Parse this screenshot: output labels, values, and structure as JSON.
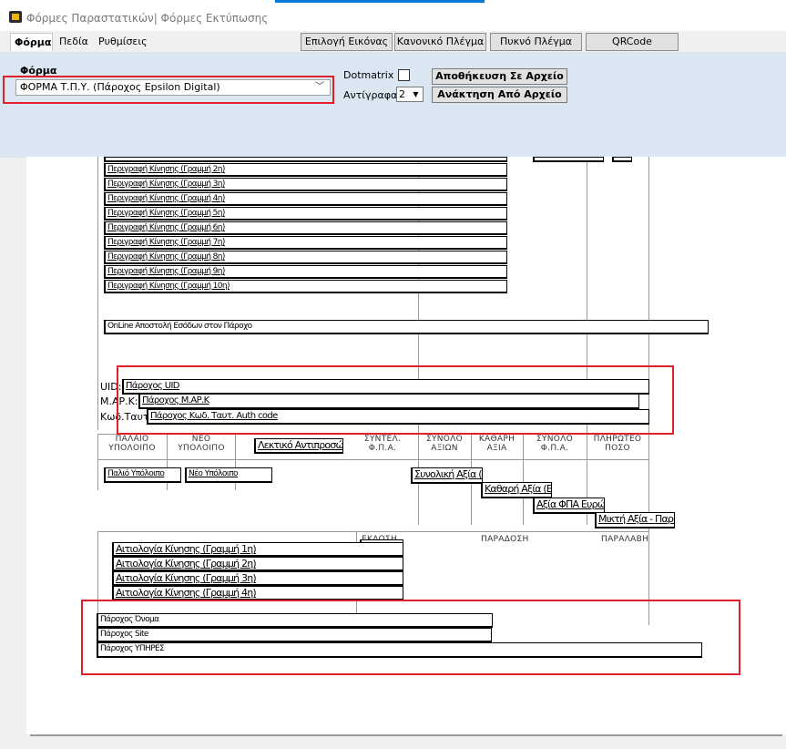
{
  "window": {
    "title": "Φόρμες Παραστατικών| Φόρμες Εκτύπωσης"
  },
  "tabs": [
    {
      "label": "Φόρμα"
    },
    {
      "label": "Πεδία"
    },
    {
      "label": "Ρυθμίσεις"
    }
  ],
  "toolbar": {
    "image_select": "Επιλογή Εικόνας",
    "normal_grid": "Κανονικό Πλέγμα",
    "dense_grid": "Πυκνό Πλέγμα",
    "qrcode": "QRCode"
  },
  "form": {
    "label": "Φόρμα",
    "selected": "ΦΟΡΜΑ Τ.Π.Υ.  (Πάροχος Epsilon Digital)",
    "dotmatrix_label": "Dotmatrix",
    "dotmatrix_checked": false,
    "copies_label": "Αντίγραφα",
    "copies_value": "2",
    "save_button": "Αποθήκευση Σε Αρχείο",
    "load_button": "Ανάκτηση Από Αρχείο"
  },
  "canvas": {
    "desc_lines": [
      "Περιγραφή Κίνησης (Γραμμή 2η)",
      "Περιγραφή Κίνησης (Γραμμή 3η)",
      "Περιγραφή Κίνησης (Γραμμή 4η)",
      "Περιγραφή Κίνησης (Γραμμή 5η)",
      "Περιγραφή Κίνησης (Γραμμή 6η)",
      "Περιγραφή Κίνησης (Γραμμή 7η)",
      "Περιγραφή Κίνησης (Γραμμή 8η)",
      "Περιγραφή Κίνησης (Γραμμή 9η)",
      "Περιγραφή Κίνησης (Γραμμή 10η)"
    ],
    "online_text": "OnLine Αποστολή Εσόδων στον Πάροχο",
    "uid_label": "UID:",
    "uid_field": "Πάροχος UID",
    "mark_label": "Μ.ΑΡ.Κ:",
    "mark_field": "Πάροχος Μ.ΑΡ.Κ",
    "auth_label": "Κωδ.Ταυτ:",
    "auth_field": "Πάροχος Κωδ. Ταυτ. Auth code",
    "col_old_balance": "ΠΑΛΑΙΟ\nΥΠΟΛΟΙΠΟ",
    "col_new_balance": "ΝΕΟ\nΥΠΟΛΟΙΠΟ",
    "legal_rep": "Λεκτικό Αντιπροσώπου Παρ",
    "col_vat_rate": "ΣΥΝΤΕΛ.\nΦ.Π.Α.",
    "col_total_values": "ΣΥΝΟΛΟ\nΑΞΙΩΝ",
    "col_net_value": "ΚΑΘΑΡΗ\nΑΞΙΑ",
    "col_vat_total": "ΣΥΝΟΛΟ\nΦ.Π.Α.",
    "col_payable": "ΠΛΗΡΩΤΕΟ\nΠΟΣΟ",
    "old_balance_field": "Παλιό Υπόλοιπο",
    "new_balance_field": "Νέο Υπόλοιπο",
    "total_value_field": "Συνολική Αξία (Ευρ",
    "net_value_field": "Καθαρή Αξία (Ευρώ)",
    "vat_value_field": "Αξία ΦΠΑ Ευρώ)",
    "gross_value_field": "Μικτή Αξία - Παρακρ",
    "issue_label": "ΕΚΔΟΣΗ",
    "delivery_label": "ΠΑΡΑΔΟΣΗ",
    "receipt_label": "ΠΑΡΑΛΑΒΗ",
    "reason_lines": [
      "Αιτιολογία Κίνησης (Γραμμή 1η)",
      "Αιτιολογία Κίνησης (Γραμμή 2η)",
      "Αιτιολογία Κίνησης (Γραμμή 3η)",
      "Αιτιολογία Κίνησης (Γραμμή 4η)"
    ],
    "provider_name": "Πάροχος Όνομα",
    "provider_site": "Πάροχος Site",
    "provider_services": "Πάροχος ΥΠΗΡΕΣ"
  }
}
